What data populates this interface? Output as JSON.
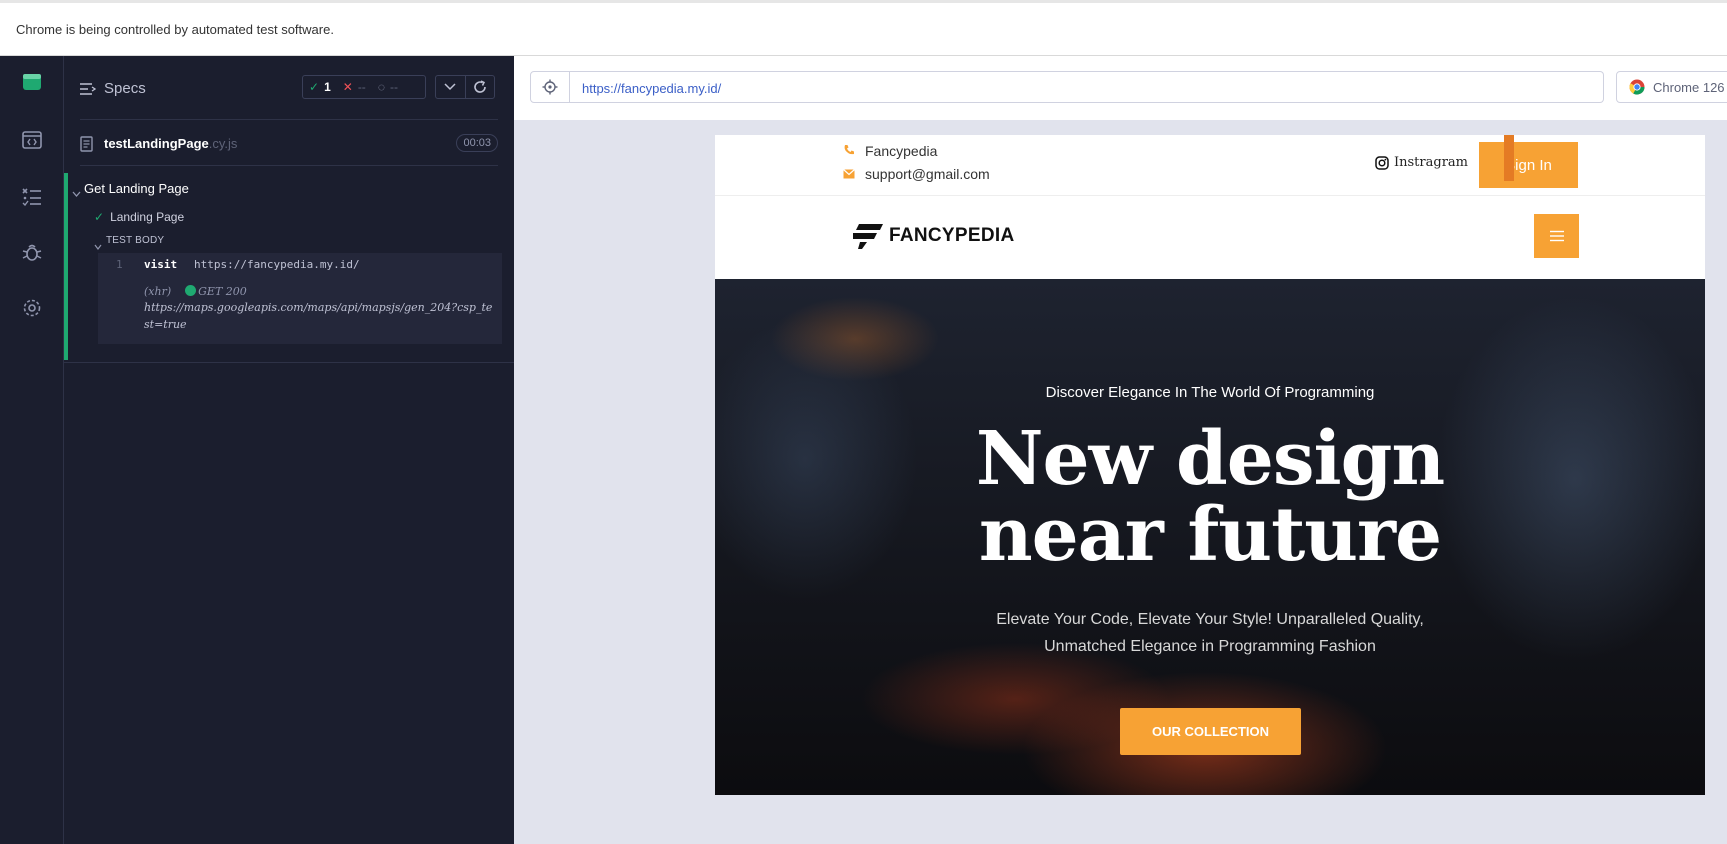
{
  "banner": {
    "text": "Chrome is being controlled by automated test software."
  },
  "reporter": {
    "specs_label": "Specs",
    "stats": {
      "passed": "1",
      "failed": "--",
      "pending": "--"
    },
    "spec_file": {
      "name": "testLandingPage",
      "ext": ".cy.js",
      "duration": "00:03"
    },
    "suite": {
      "title": "Get Landing Page",
      "test_title": "Landing Page",
      "body_label": "TEST BODY",
      "commands": [
        {
          "line": "1",
          "name": "visit",
          "arg": "https://fancypedia.my.id/"
        }
      ],
      "xhr": {
        "label": "(xhr)",
        "status": "GET 200",
        "url": "https://maps.googleapis.com/maps/api/mapsjs/gen_204?csp_test=true"
      }
    }
  },
  "aut": {
    "url": "https://fancypedia.my.id/",
    "browser": "Chrome 126"
  },
  "site": {
    "topbar": {
      "phone_label": "Fancypedia",
      "email": "support@gmail.com",
      "instagram": "Instragram",
      "signin": "Sign In"
    },
    "logo_text": "FANCYPEDIA",
    "hero": {
      "kicker": "Discover Elegance In The World Of Programming",
      "title_line1": "New design",
      "title_line2": "near future",
      "subtitle": "Elevate Your Code, Elevate Your Style! Unparalleled Quality, Unmatched Elegance in Programming Fashion",
      "cta": "OUR COLLECTION"
    },
    "colors": {
      "accent": "#f7a234",
      "pass": "#1fa971",
      "fail": "#f05258"
    }
  }
}
